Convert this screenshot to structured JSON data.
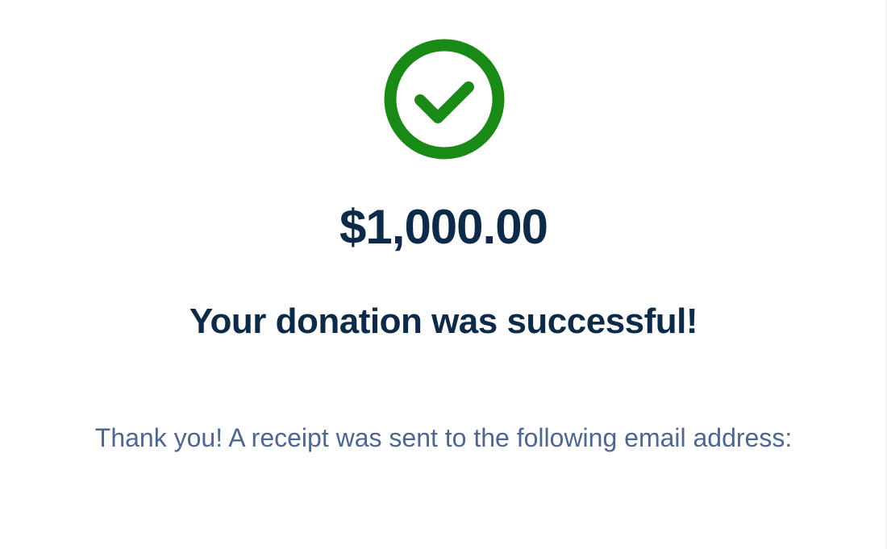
{
  "colors": {
    "success_green": "#1a8a16",
    "heading_navy": "#0d2b48",
    "message_slate": "#4f6690",
    "background": "#ffffff"
  },
  "status": {
    "icon": "check-circle-icon"
  },
  "donation": {
    "amount": "$1,000.00",
    "headline": "Your donation was successful!"
  },
  "receipt": {
    "message": "Thank you! A receipt was sent to the following email address:"
  }
}
